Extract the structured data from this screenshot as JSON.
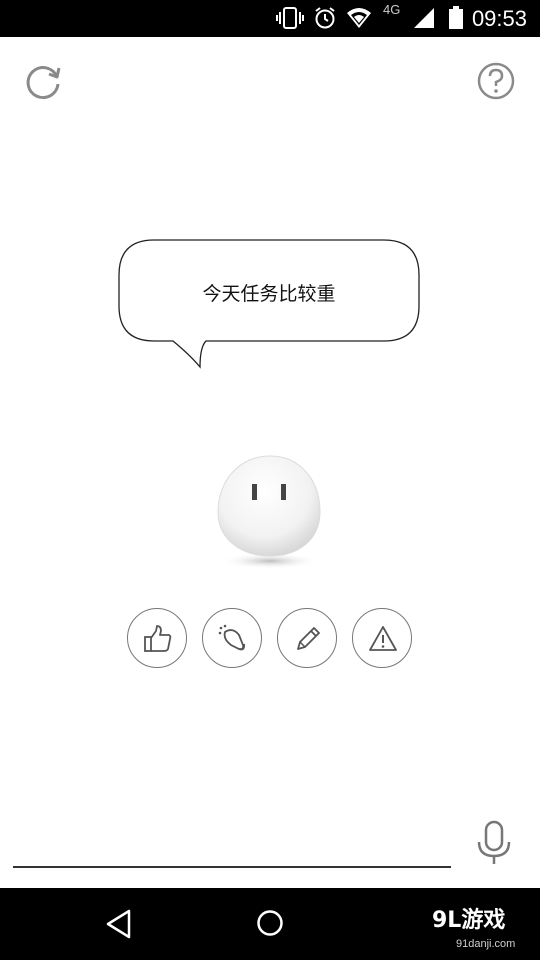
{
  "status_bar": {
    "time": "09:53",
    "network": "4G",
    "icons": [
      "vibrate-icon",
      "alarm-icon",
      "wifi-icon",
      "signal-icon",
      "battery-icon"
    ]
  },
  "top_bar": {
    "left_icon": "refresh-icon",
    "right_icon": "help-icon"
  },
  "bubble": {
    "text": "今天任务比较重"
  },
  "character": {
    "icon": "ghost-character"
  },
  "actions": [
    {
      "icon": "thumbs-up-icon"
    },
    {
      "icon": "feed-icon"
    },
    {
      "icon": "pencil-icon"
    },
    {
      "icon": "warning-icon"
    }
  ],
  "input": {
    "icon": "microphone-icon"
  },
  "nav_bar": {
    "back_icon": "back-triangle-icon",
    "home_icon": "home-circle-icon"
  },
  "watermark": {
    "logo": "9L游戏",
    "url": "91danji.com"
  },
  "colors": {
    "status_bar_bg": "#000000",
    "page_bg": "#ffffff",
    "icon_gray": "#777777",
    "nav_bar_bg": "#000000"
  }
}
